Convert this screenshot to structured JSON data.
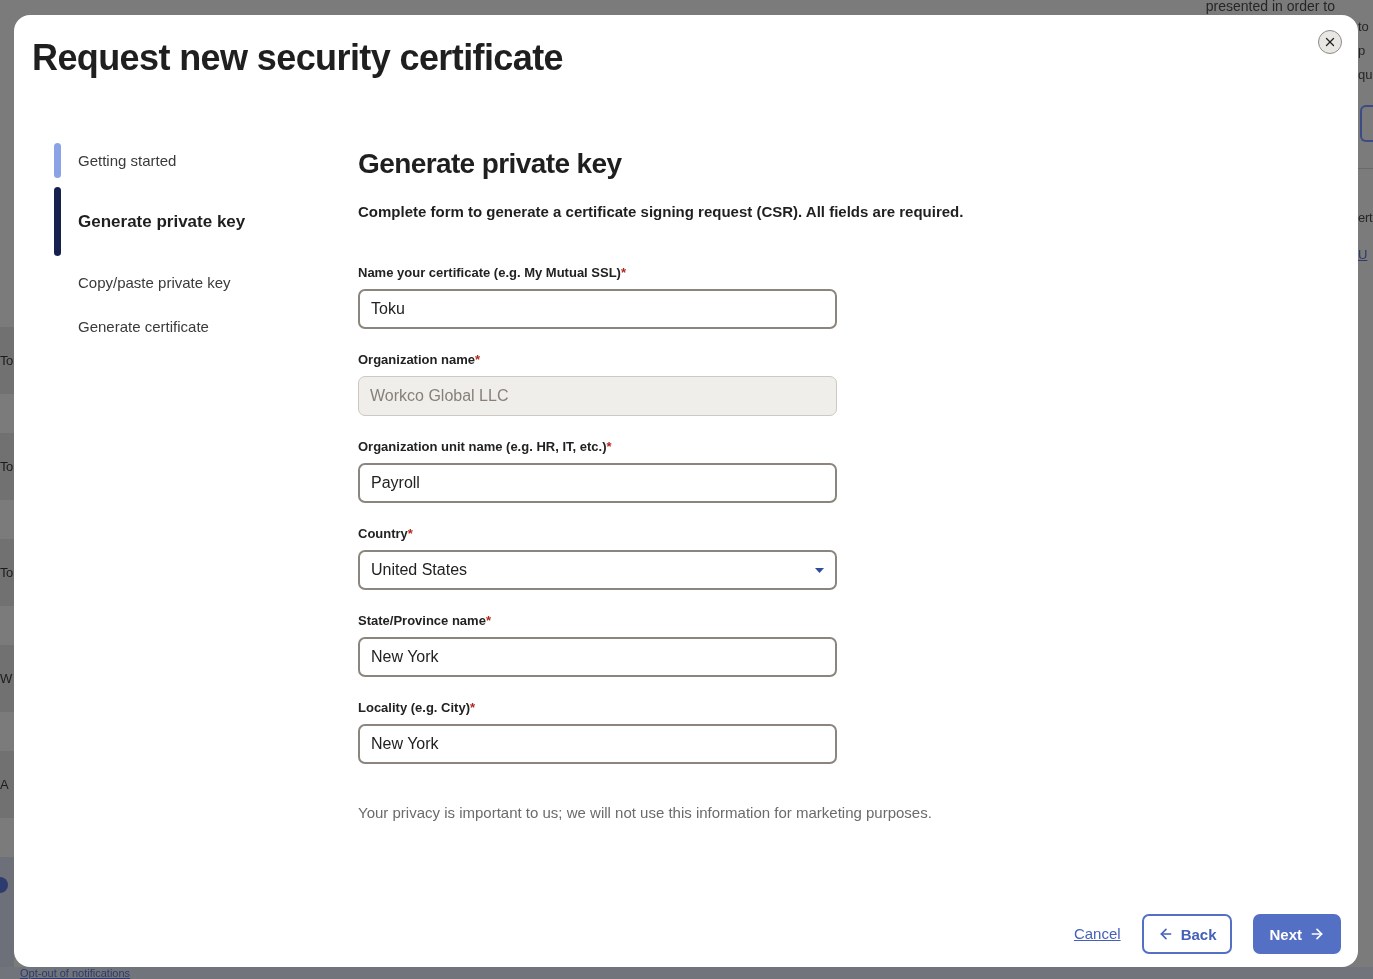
{
  "background_page": {
    "top_text": "presented in order to",
    "left_rows": [
      "To",
      "To",
      "To",
      "W",
      "A"
    ],
    "right_texts": [
      "to",
      "p",
      "qu"
    ],
    "right_lower_text": "ert",
    "right_link": "U",
    "bottom_link": "Opt-out of notifications"
  },
  "dialog": {
    "title": "Request new security certificate"
  },
  "steps": [
    {
      "label": "Getting started",
      "selected": false,
      "completed": true
    },
    {
      "label": "Generate private key",
      "selected": true,
      "completed": false
    },
    {
      "label": "Copy/paste private key",
      "selected": false,
      "completed": false
    },
    {
      "label": "Generate certificate",
      "selected": false,
      "completed": false
    }
  ],
  "form": {
    "heading": "Generate private key",
    "instructions": "Complete form to generate a certificate signing request (CSR). All fields are required.",
    "fields": [
      {
        "kind": "text",
        "label": "Name your certificate (e.g. My Mutual SSL)",
        "required_mark": "*",
        "value": "Toku",
        "disabled": false
      },
      {
        "kind": "text",
        "label": "Organization name",
        "required_mark": "*",
        "value": "Workco Global LLC",
        "disabled": true
      },
      {
        "kind": "text",
        "label": "Organization unit name (e.g. HR, IT, etc.)",
        "required_mark": "*",
        "value": "Payroll",
        "disabled": false
      },
      {
        "kind": "select",
        "label": "Country",
        "required_mark": "*",
        "value": "United States",
        "disabled": false
      },
      {
        "kind": "text",
        "label": "State/Province name",
        "required_mark": "*",
        "value": "New York",
        "disabled": false
      },
      {
        "kind": "text",
        "label": "Locality (e.g. City)",
        "required_mark": "*",
        "value": "New York",
        "disabled": false
      }
    ]
  },
  "privacy_note": "Your privacy is important to us; we will not use this information for marketing purposes.",
  "footer": {
    "cancel": "Cancel",
    "back": "Back",
    "next": "Next"
  }
}
